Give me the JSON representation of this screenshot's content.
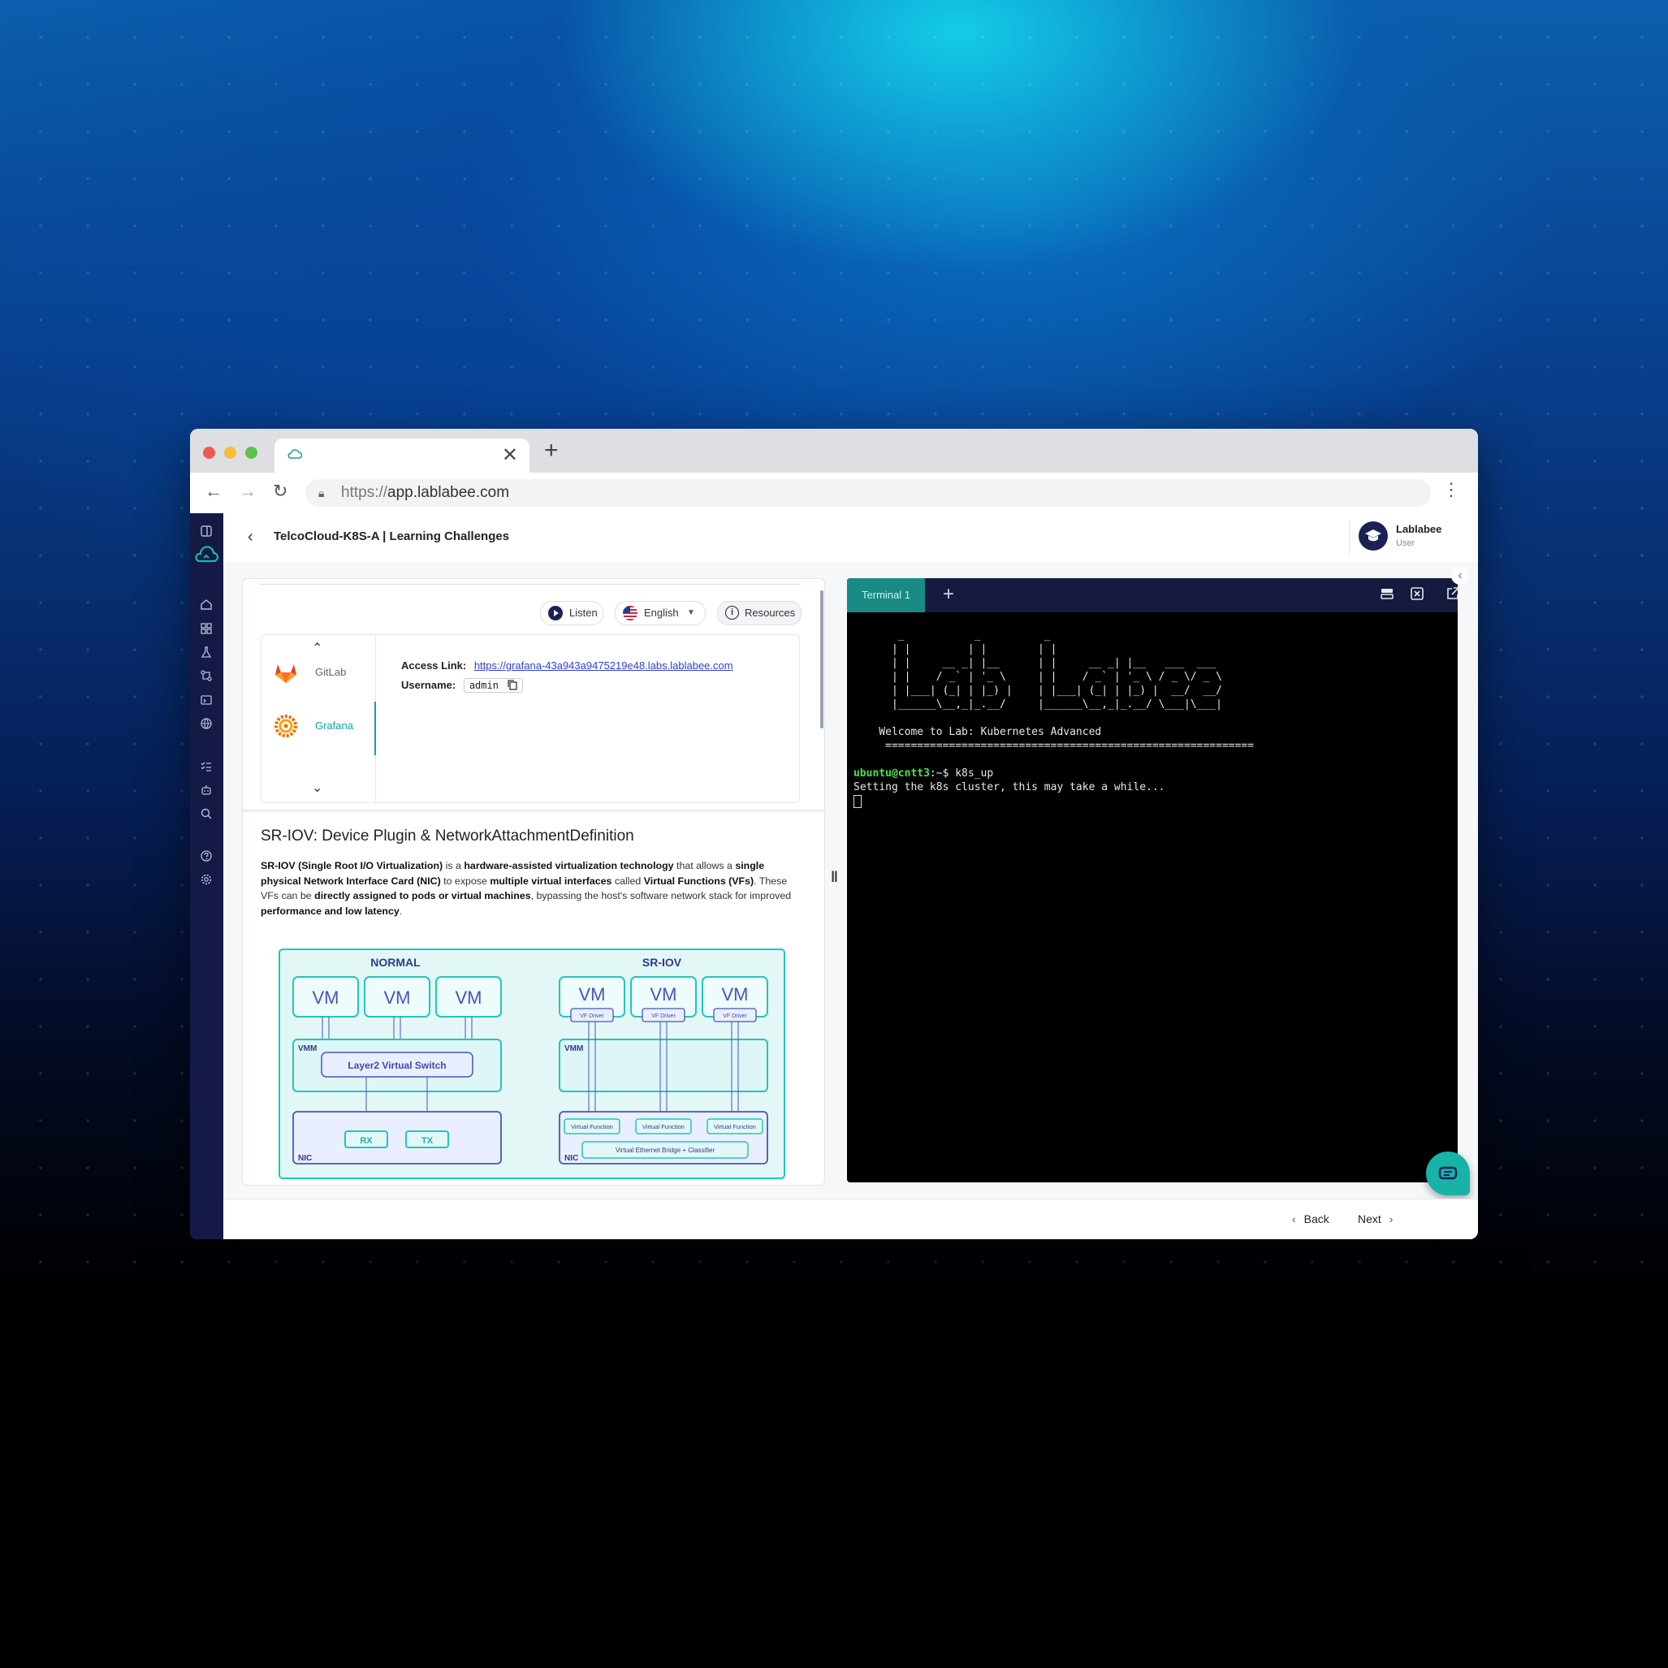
{
  "browser": {
    "url_protocol": "https://",
    "url_host": "app.lablabee.com",
    "new_tab_label": "+",
    "tab_close": "✕"
  },
  "header": {
    "title": "TelcoCloud-K8S-A | Learning Challenges",
    "user_name": "Lablabee",
    "user_role": "User"
  },
  "toolbar": {
    "listen_label": "Listen",
    "language_label": "English",
    "resources_label": "Resources"
  },
  "resources": {
    "items": [
      {
        "label": "GitLab"
      },
      {
        "label": "Grafana"
      }
    ],
    "access_link_label": "Access Link:",
    "access_link_value": "https://grafana-43a943a9475219e48.labs.lablabee.com",
    "username_label": "Username:",
    "username_value": "admin"
  },
  "lesson": {
    "title": "SR-IOV: Device Plugin & NetworkAttachmentDefinition"
  },
  "diagram": {
    "normal_title": "NORMAL",
    "sriov_title": "SR-IOV",
    "vm_label": "VM",
    "vf_driver_label": "VF Driver",
    "vmm_label": "VMM",
    "nic_label": "NIC",
    "switch_label": "Layer2 Virtual Switch",
    "rx_label": "RX",
    "tx_label": "TX",
    "vf_label": "Virtual Function",
    "bridge_label": "Virtual Ethernet Bridge + Classifier"
  },
  "terminal": {
    "tab_label": "Terminal 1",
    "add_label": "+",
    "banner": "       _           _          _\n      | |         | |        | |\n      | |     __ _| |__      | |     __ _| |__   ___  ___\n      | |    / _` | '_ \\     | |    / _` | '_ \\ / _ \\/ _ \\\n      | |___| (_| | |_) |    | |___| (_| | |_) |  __/  __/\n      |______\\__,_|_.__/     |______\\__,_|_.__/ \\___|\\___|",
    "welcome": "    Welcome to Lab: Kubernetes Advanced",
    "rule": "     ==========================================================",
    "prompt_user": "ubuntu@cntt3",
    "prompt_rest": ":~$ k8s_up",
    "output": "Setting the k8s cluster, this may take a while..."
  },
  "footer": {
    "back_label": "Back",
    "next_label": "Next"
  },
  "colors": {
    "accent": "#16a39a",
    "sidebar": "#141a45",
    "link": "#2f3fd6"
  }
}
